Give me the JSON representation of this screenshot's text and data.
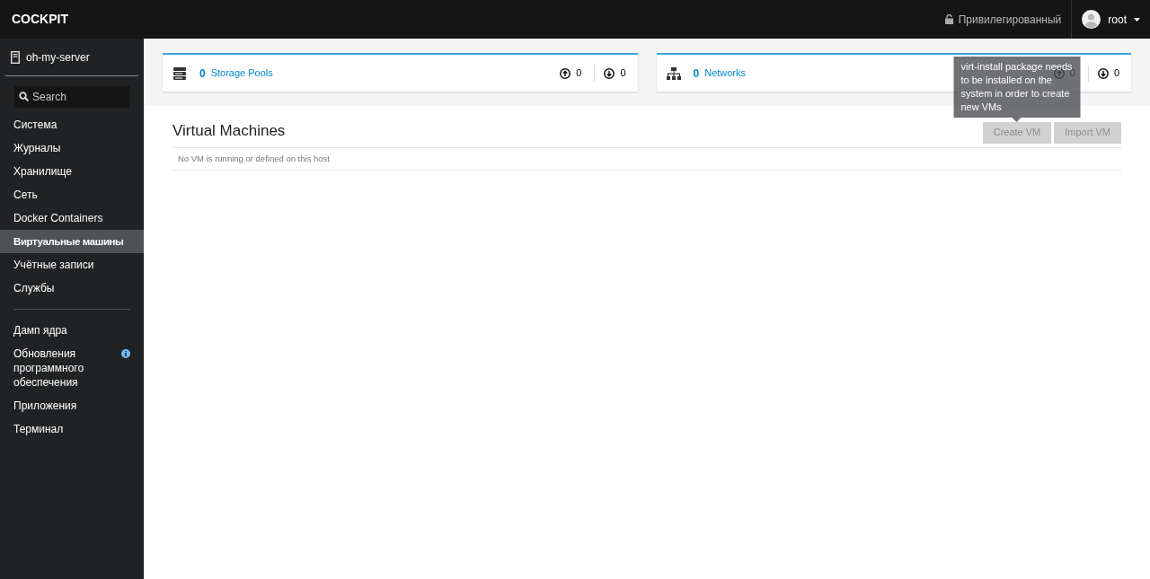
{
  "brand": "COCKPIT",
  "topbar": {
    "privilege": "Привилегированный",
    "user": "root"
  },
  "sidebar": {
    "host": "oh-my-server",
    "search": {
      "placeholder": "Search"
    },
    "groups": [
      [
        {
          "label": "Система",
          "selected": false,
          "info": false
        },
        {
          "label": "Журналы",
          "selected": false,
          "info": false
        },
        {
          "label": "Хранилище",
          "selected": false,
          "info": false
        },
        {
          "label": "Сеть",
          "selected": false,
          "info": false
        },
        {
          "label": "Docker Containers",
          "selected": false,
          "info": false
        },
        {
          "label": "Виртуальные машины",
          "selected": true,
          "info": false
        },
        {
          "label": "Учётные записи",
          "selected": false,
          "info": false
        },
        {
          "label": "Службы",
          "selected": false,
          "info": false
        }
      ],
      [
        {
          "label": "Дамп ядра",
          "selected": false,
          "info": false
        },
        {
          "label": "Обновления программного обеспечения",
          "selected": false,
          "info": true
        },
        {
          "label": "Приложения",
          "selected": false,
          "info": false
        },
        {
          "label": "Терминал",
          "selected": false,
          "info": false
        }
      ]
    ]
  },
  "cards": [
    {
      "kind": "storage",
      "count": "0",
      "label": "Storage Pools",
      "up": "0",
      "down": "0"
    },
    {
      "kind": "network",
      "count": "0",
      "label": "Networks",
      "up": "0",
      "down": "0"
    }
  ],
  "vms": {
    "title": "Virtual Machines",
    "empty": "No VM is running or defined on this host",
    "buttons": [
      {
        "label": "Create VM",
        "disabled": true,
        "tooltip": "virt-install package needs to be installed on the system in order to create new VMs"
      },
      {
        "label": "Import VM",
        "disabled": true
      }
    ]
  }
}
